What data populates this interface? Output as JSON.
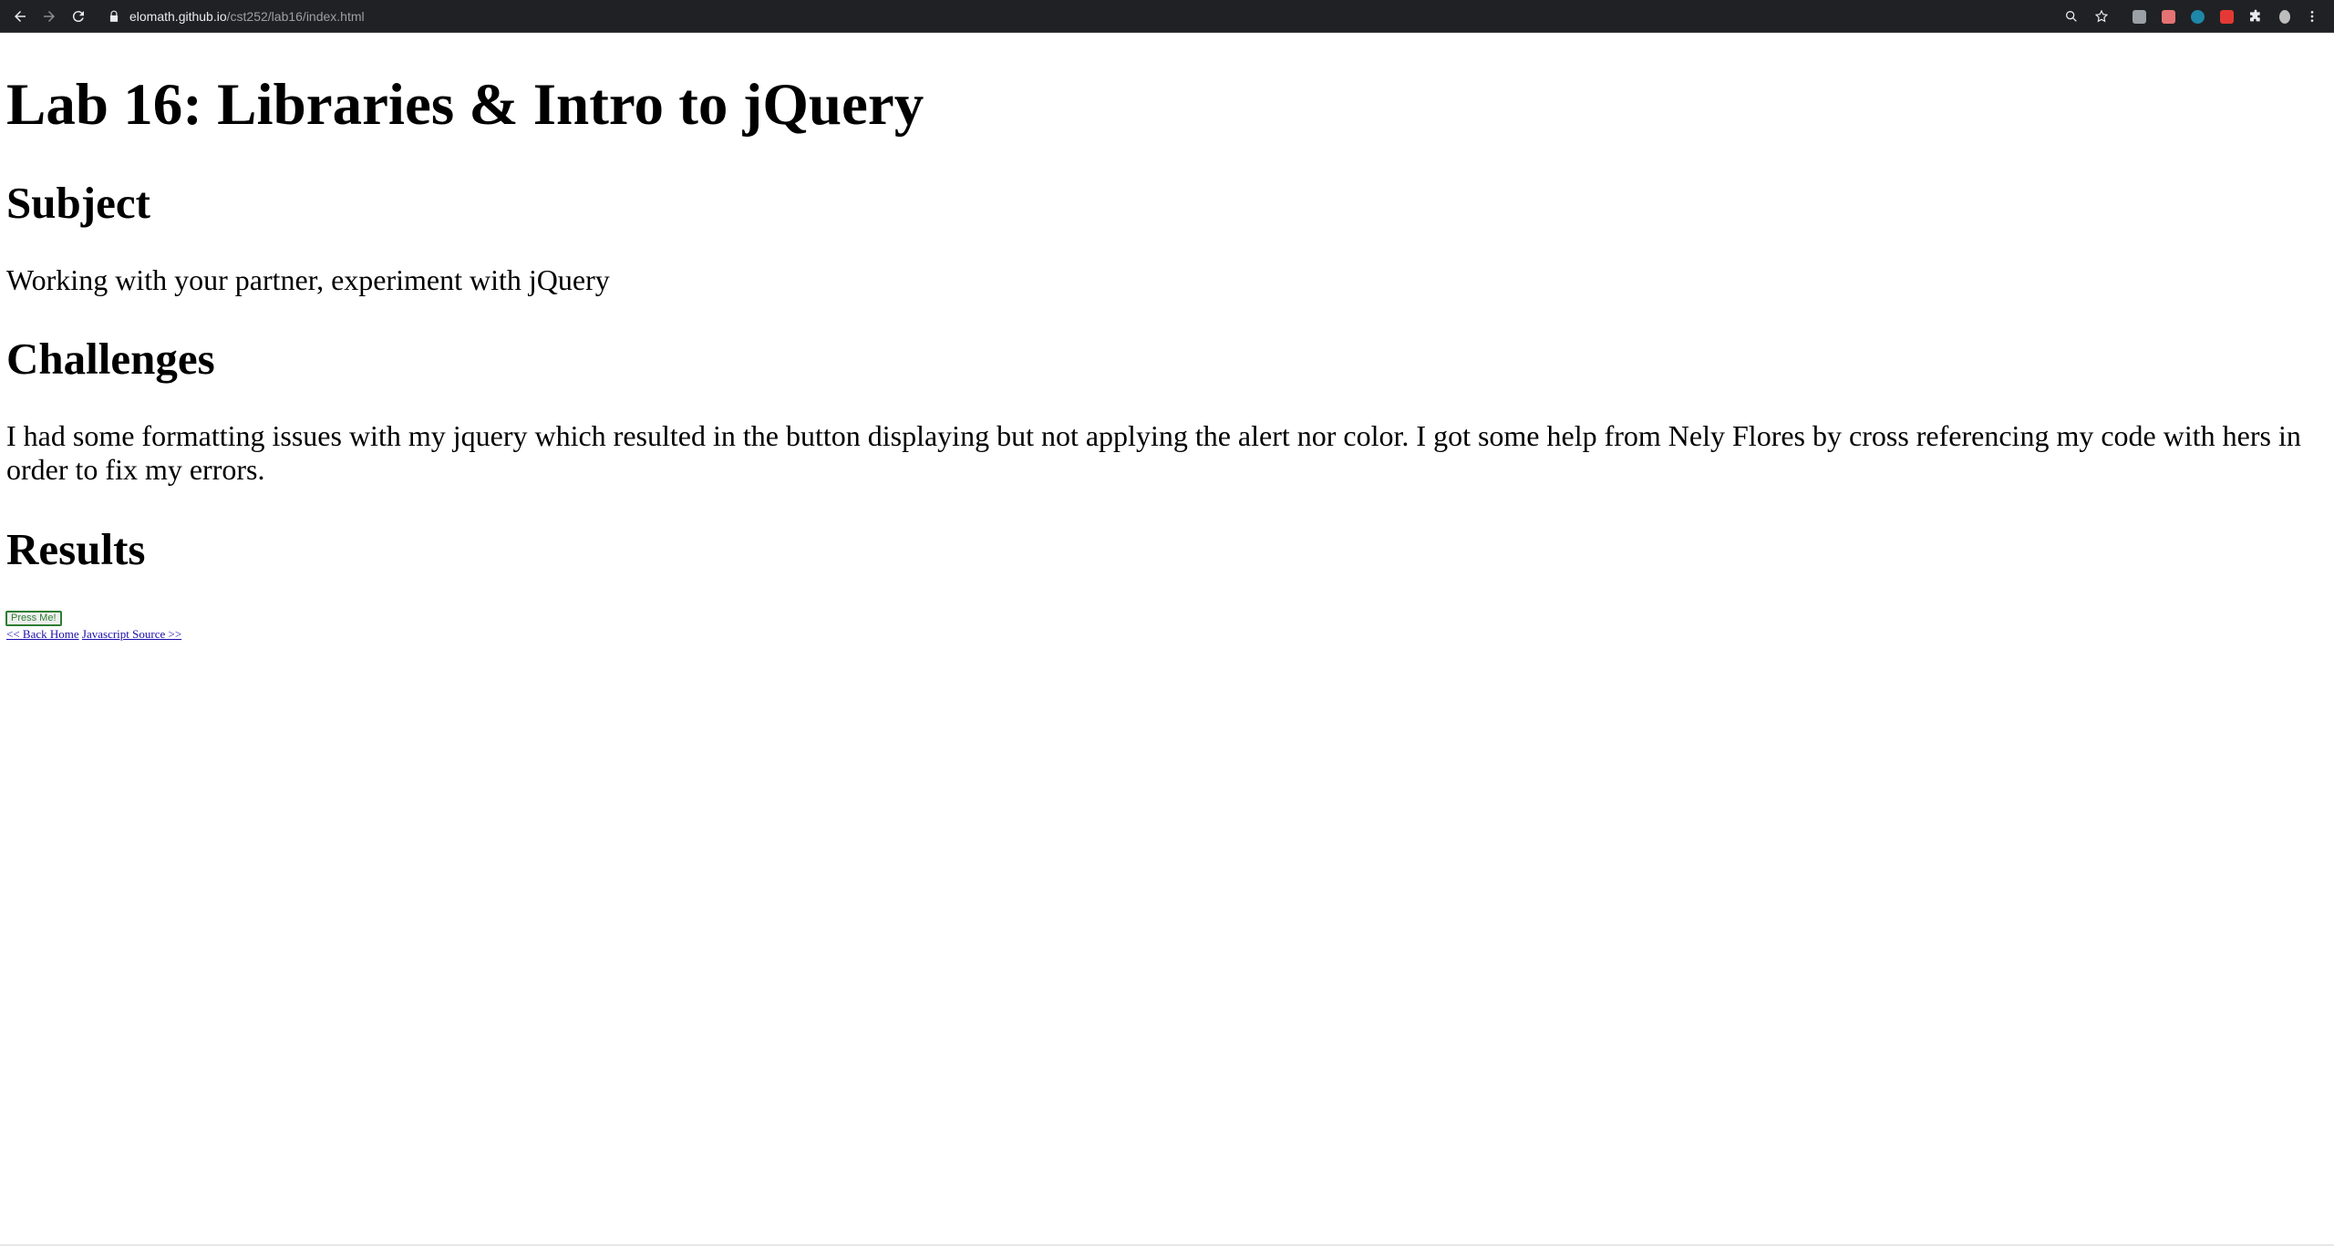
{
  "browser": {
    "url_host": "elomath.github.io",
    "url_path": "/cst252/lab16/index.html",
    "nav_icons": [
      "back-arrow-icon",
      "forward-arrow-icon",
      "reload-icon",
      "lock-icon"
    ],
    "toolbar_icons": [
      "zoom-icon",
      "bookmark-star-icon",
      "extension-icon",
      "puzzle-extensions-icon",
      "profile-icon",
      "menu-icon"
    ],
    "extension_colors": [
      "#9aa0a6",
      "#e57373",
      "#1e88a8",
      "#e53935"
    ]
  },
  "page": {
    "title": "Lab 16: Libraries & Intro to jQuery",
    "sections": [
      {
        "heading": "Subject",
        "text": "Working with your partner, experiment with jQuery"
      },
      {
        "heading": "Challenges",
        "text": "I had some formatting issues with my jquery which resulted in the button displaying but not applying the alert nor color. I got some help from Nely Flores by cross referencing my code with hers in order to fix my errors."
      },
      {
        "heading": "Results"
      }
    ],
    "button_label": "Press Me!",
    "links": {
      "back": "<< Back Home",
      "source": "Javascript Source >>"
    }
  }
}
